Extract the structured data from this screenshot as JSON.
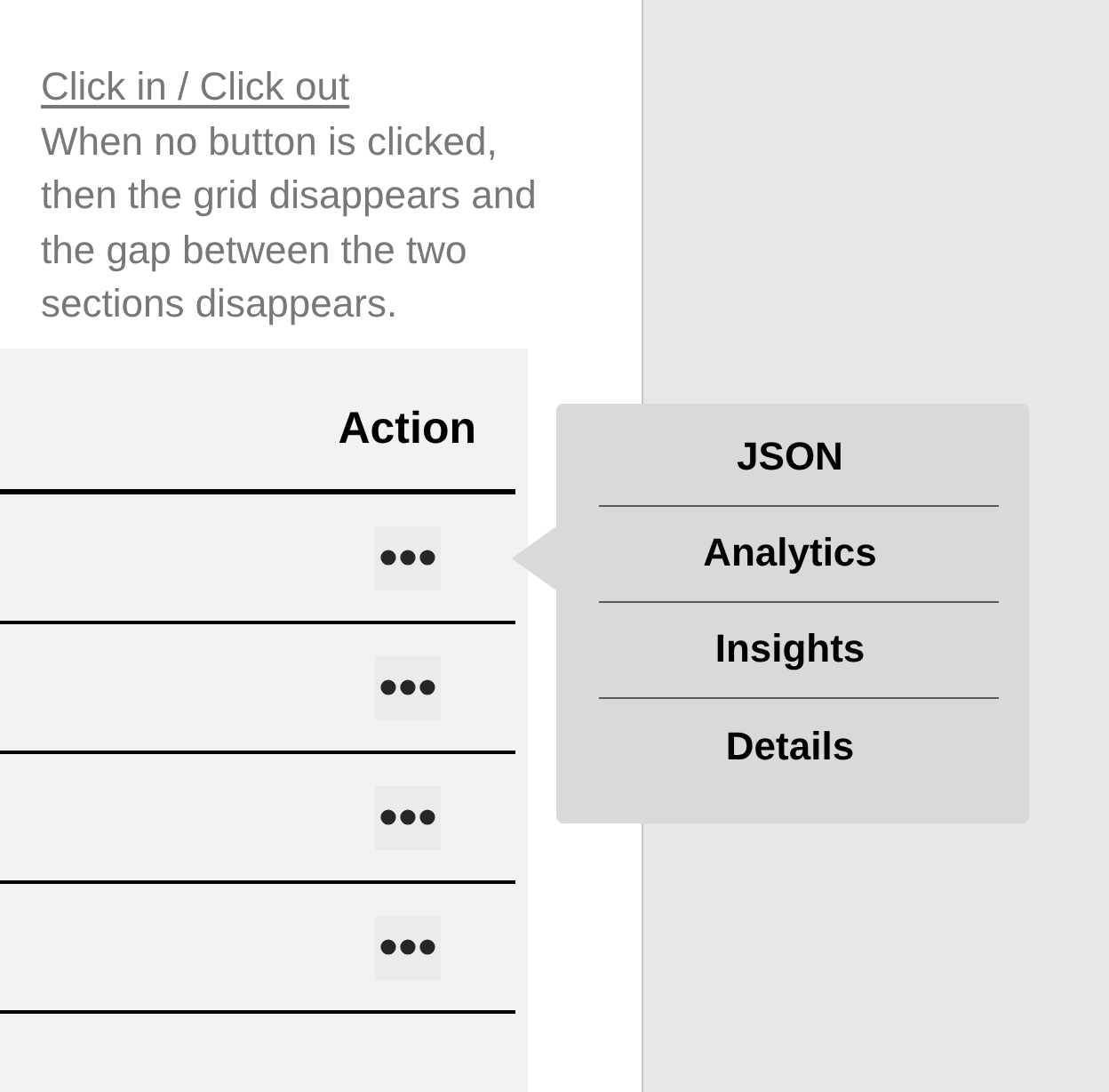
{
  "note": {
    "title": "Click in / Click out",
    "text": "When no button is clicked, then the grid disappears and the gap between the two sections disappears."
  },
  "grid": {
    "columns": [
      "Action"
    ],
    "rows": [
      {
        "menu_open": true
      },
      {
        "menu_open": false
      },
      {
        "menu_open": false
      },
      {
        "menu_open": false
      }
    ]
  },
  "menu": {
    "items": [
      "JSON",
      "Analytics",
      "Insights",
      "Details"
    ]
  }
}
